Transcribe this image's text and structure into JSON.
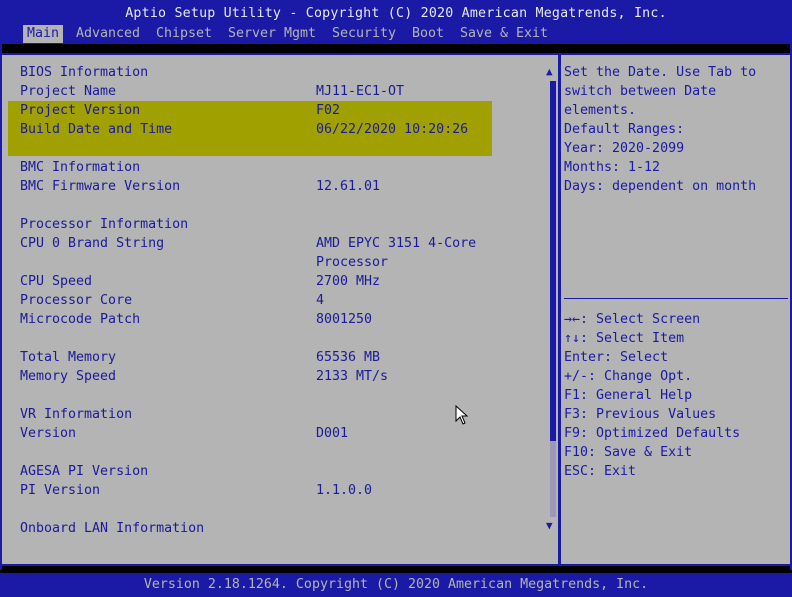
{
  "header": {
    "title": "Aptio Setup Utility - Copyright (C) 2020 American Megatrends, Inc.",
    "tabs": [
      {
        "label": "Main",
        "active": true
      },
      {
        "label": "Advanced"
      },
      {
        "label": "Chipset"
      },
      {
        "label": "Server Mgmt"
      },
      {
        "label": "Security"
      },
      {
        "label": "Boot"
      },
      {
        "label": "Save & Exit"
      }
    ]
  },
  "main": {
    "bios_information": "BIOS Information",
    "project_name_label": "Project Name",
    "project_name_value": "MJ11-EC1-OT",
    "project_version_label": "Project Version",
    "project_version_value": "F02",
    "build_date_label": "Build Date and Time",
    "build_date_value": "06/22/2020 10:20:26",
    "bmc_information": "BMC Information",
    "bmc_fw_label": "BMC Firmware Version",
    "bmc_fw_value": "12.61.01",
    "processor_information": "Processor Information",
    "cpu_brand_label": "CPU 0 Brand String",
    "cpu_brand_value_1": "AMD EPYC 3151 4-Core",
    "cpu_brand_value_2": "Processor",
    "cpu_speed_label": "CPU Speed",
    "cpu_speed_value": "2700 MHz",
    "processor_core_label": "Processor Core",
    "processor_core_value": "4",
    "microcode_label": "Microcode Patch",
    "microcode_value": "8001250",
    "total_memory_label": "Total Memory",
    "total_memory_value": "65536 MB",
    "memory_speed_label": "Memory Speed",
    "memory_speed_value": "2133 MT/s",
    "vr_information": "VR Information",
    "vr_version_label": "Version",
    "vr_version_value": "D001",
    "agesa_pi_version": "AGESA PI Version",
    "pi_version_label": "PI Version",
    "pi_version_value": "1.1.0.0",
    "onboard_lan": "Onboard LAN Information"
  },
  "help": {
    "description": [
      "Set the Date. Use Tab to",
      "switch between Date",
      "elements.",
      "Default Ranges:",
      "Year: 2020-2099",
      "Months: 1-12",
      "Days: dependent on month"
    ],
    "keys": [
      "→←: Select Screen",
      "↑↓: Select Item",
      "Enter: Select",
      "+/-: Change Opt.",
      "F1: General Help",
      "F3: Previous Values",
      "F9: Optimized Defaults",
      "F10: Save & Exit",
      "ESC: Exit"
    ]
  },
  "footer": {
    "text": "Version 2.18.1264. Copyright (C) 2020 American Megatrends, Inc."
  },
  "colors": {
    "frame_blue": "#1a1aa6",
    "panel_gray": "#b4b4b4",
    "highlight_olive": "#a0a000"
  }
}
